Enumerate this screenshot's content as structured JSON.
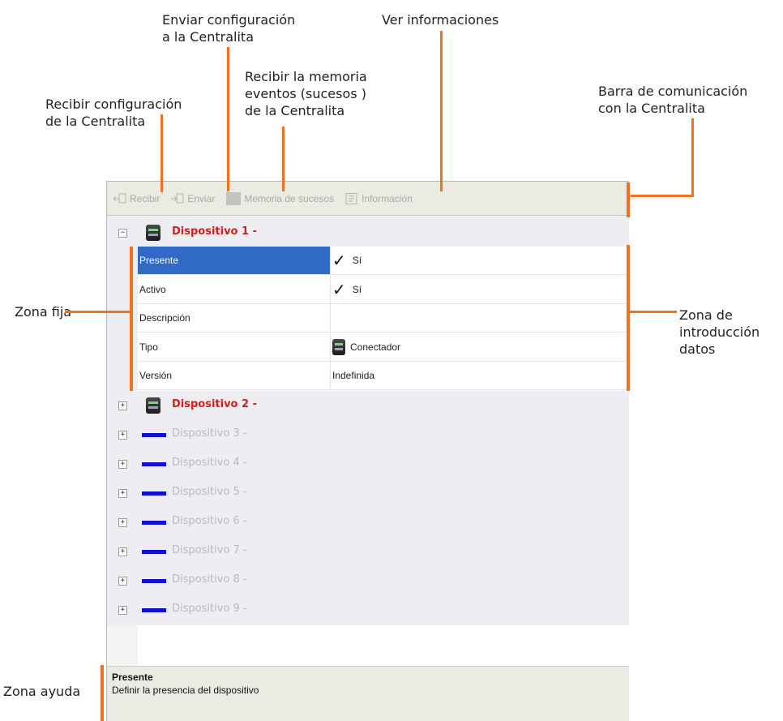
{
  "callouts": {
    "recibir_config": "Recibir configuración\nde la Centralita",
    "enviar_config": "Enviar configuración\na la Centralita",
    "memoria": "Recibir la memoria\neventos (sucesos )\nde la Centralita",
    "ver_info": "Ver informaciones",
    "barra": "Barra de comunicación\ncon la Centralita",
    "zona_fija": "Zona fija",
    "zona_introduccion": "Zona de\nintroducción\ndatos",
    "zona_ayuda": "Zona ayuda"
  },
  "toolbar": {
    "recibir_label": "Recibir",
    "enviar_label": "Enviar",
    "memoria_label": "Memoria de sucesos",
    "informacion_label": "Información"
  },
  "devices": [
    {
      "label": "Dispositivo 1 -",
      "expander": "−",
      "state": "active",
      "icon": "device-module-icon"
    },
    {
      "label": "Dispositivo 2 -",
      "expander": "+",
      "state": "active",
      "icon": "device-module-icon"
    },
    {
      "label": "Dispositivo 3 -",
      "expander": "+",
      "state": "inactive",
      "icon": "blue-bar-icon"
    },
    {
      "label": "Dispositivo 4 -",
      "expander": "+",
      "state": "inactive",
      "icon": "blue-bar-icon"
    },
    {
      "label": "Dispositivo 5 -",
      "expander": "+",
      "state": "inactive",
      "icon": "blue-bar-icon"
    },
    {
      "label": "Dispositivo 6 -",
      "expander": "+",
      "state": "inactive",
      "icon": "blue-bar-icon"
    },
    {
      "label": "Dispositivo 7 -",
      "expander": "+",
      "state": "inactive",
      "icon": "blue-bar-icon"
    },
    {
      "label": "Dispositivo 8 -",
      "expander": "+",
      "state": "inactive",
      "icon": "blue-bar-icon"
    },
    {
      "label": "Dispositivo 9 -",
      "expander": "+",
      "state": "inactive",
      "icon": "blue-bar-icon"
    }
  ],
  "properties": [
    {
      "name": "Presente",
      "value": "Sí",
      "check": true,
      "selected": true
    },
    {
      "name": "Activo",
      "value": "Sí",
      "check": true,
      "selected": false
    },
    {
      "name": "Descripción",
      "value": "",
      "check": false,
      "selected": false
    },
    {
      "name": "Tipo",
      "value": "Conectador",
      "check": false,
      "selected": false
    },
    {
      "name": "Versión",
      "value": "Indefinida",
      "check": false,
      "selected": false
    }
  ],
  "help": {
    "title": "Presente",
    "text": "Definir la presencia del dispositivo"
  },
  "colors": {
    "callout_line": "#f36f21",
    "selection": "#3169c6",
    "device_active": "#d81b1b",
    "device_inactive": "#b6b8c6",
    "device_bar": "#1010d0"
  }
}
